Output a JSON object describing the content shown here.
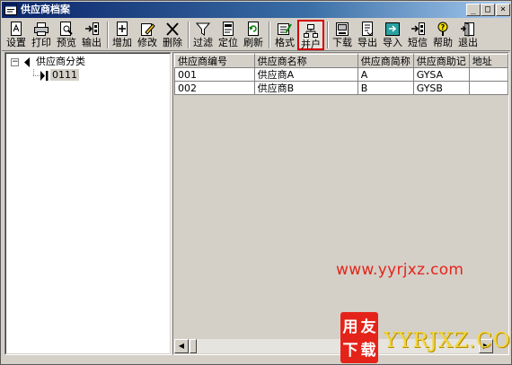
{
  "window": {
    "title": "供应商档案",
    "controls": {
      "minimize": "_",
      "maximize": "□",
      "close": "×"
    }
  },
  "toolbar": {
    "buttons": [
      {
        "id": "setup",
        "label": "设置",
        "icon": "page-setup-icon"
      },
      {
        "id": "print",
        "label": "打印",
        "icon": "printer-icon"
      },
      {
        "id": "preview",
        "label": "预览",
        "icon": "print-preview-icon"
      },
      {
        "id": "output",
        "label": "输出",
        "icon": "output-icon"
      },
      {
        "id": "add",
        "label": "增加",
        "icon": "add-icon"
      },
      {
        "id": "modify",
        "label": "修改",
        "icon": "edit-icon"
      },
      {
        "id": "delete",
        "label": "删除",
        "icon": "delete-x-icon"
      },
      {
        "id": "filter",
        "label": "过滤",
        "icon": "filter-funnel-icon"
      },
      {
        "id": "locate",
        "label": "定位",
        "icon": "locate-icon"
      },
      {
        "id": "refresh",
        "label": "刷新",
        "icon": "refresh-icon"
      },
      {
        "id": "format",
        "label": "格式",
        "icon": "format-icon"
      },
      {
        "id": "open-account",
        "label": "并户",
        "icon": "merge-account-icon"
      },
      {
        "id": "download",
        "label": "下载",
        "icon": "download-icon"
      },
      {
        "id": "export",
        "label": "导出",
        "icon": "export-icon"
      },
      {
        "id": "import",
        "label": "导入",
        "icon": "import-icon"
      },
      {
        "id": "sms",
        "label": "短信",
        "icon": "sms-icon"
      },
      {
        "id": "help",
        "label": "帮助",
        "icon": "help-icon"
      },
      {
        "id": "exit",
        "label": "退出",
        "icon": "exit-door-icon"
      }
    ]
  },
  "tree": {
    "root_label": "供应商分类",
    "toggle": "−",
    "child_label": "0111"
  },
  "grid": {
    "columns": [
      "供应商编号",
      "供应商名称",
      "供应商简称",
      "供应商助记",
      "地址"
    ],
    "rows": [
      [
        "001",
        "供应商A",
        "A",
        "GYSA",
        ""
      ],
      [
        "002",
        "供应商B",
        "B",
        "GYSB",
        ""
      ]
    ]
  },
  "scrollbar": {
    "left_arrow": "◀",
    "right_arrow": "▶"
  },
  "watermark": {
    "url": "www.yyrjxz.com",
    "logo_text": "YYRJXZ.COM",
    "logo_chars": "用友下载",
    "colors": {
      "url": "#e4241a",
      "logo_bg": "#e4241a",
      "logo_text": "#f2d63b"
    }
  }
}
